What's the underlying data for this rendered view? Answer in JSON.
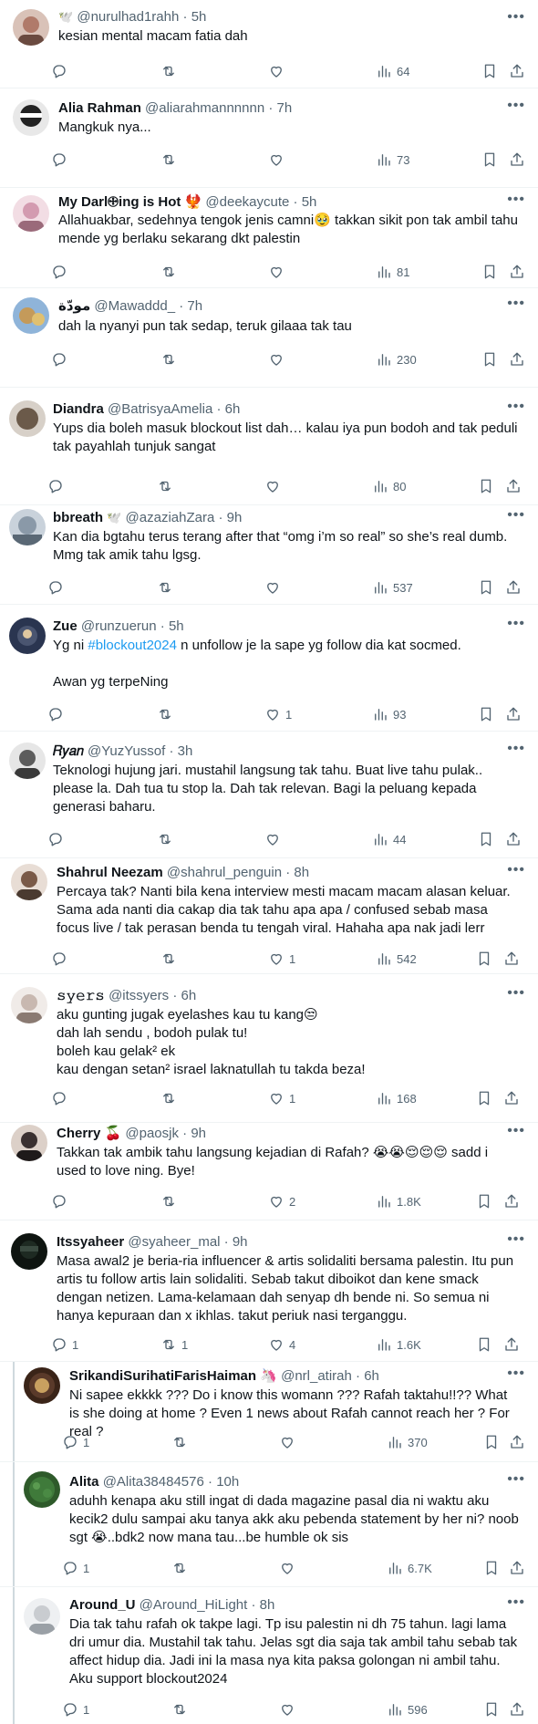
{
  "tweets": [
    {
      "name": "",
      "badge": "🕊️",
      "handle": "@nurulhad1rahh",
      "time": "5h",
      "text": "kesian mental macam fatia dah",
      "replies": "",
      "retweets": "",
      "likes": "",
      "views": "64",
      "avatar_color": "#b07a6a"
    },
    {
      "name": "Alia Rahman",
      "badge": "",
      "handle": "@aliarahmannnnnn",
      "time": "7h",
      "text": "Mangkuk nya...",
      "replies": "",
      "retweets": "",
      "likes": "",
      "views": "73",
      "avatar_color": "#222222"
    },
    {
      "name": "My Darl🕀ing is Hot 🐦‍🔥",
      "badge": "",
      "handle": "@deekaycute",
      "time": "5h",
      "text": "Allahuakbar, sedehnya tengok jenis camni🥹 takkan sikit pon tak ambil tahu mende yg berlaku sekarang dkt palestin",
      "replies": "",
      "retweets": "",
      "likes": "",
      "views": "81",
      "avatar_color": "#d39bb0"
    },
    {
      "name": "مودّة",
      "badge": "",
      "handle": "@Mawaddd_",
      "time": "7h",
      "text": "dah la nyanyi pun tak sedap, teruk gilaaa tak tau",
      "replies": "",
      "retweets": "",
      "likes": "",
      "views": "230",
      "avatar_color": "#c49a5a"
    },
    {
      "name": "Diandra",
      "badge": "",
      "handle": "@BatrisyaAmelia",
      "time": "6h",
      "text": "Yups dia boleh masuk blockout list dah… kalau iya pun bodoh and tak peduli tak payahlah tunjuk sangat",
      "replies": "",
      "retweets": "",
      "likes": "",
      "views": "80",
      "avatar_color": "#6b5a4a"
    },
    {
      "name": "bbreath",
      "badge": "🕊️",
      "handle": "@azaziahZara",
      "time": "9h",
      "text": "Kan dia bgtahu terus terang after that “omg i’m so real” so she’s real dumb. Mmg tak amik tahu lgsg.",
      "replies": "",
      "retweets": "",
      "likes": "",
      "views": "537",
      "avatar_color": "#8a99a8"
    },
    {
      "name": "Zue",
      "badge": "",
      "handle": "@runzuerun",
      "time": "5h",
      "text_before": "Yg ni ",
      "hashtag": "#blockout2024",
      "text_after": " n unfollow je la sape yg follow dia kat socmed.\n\nAwan yg terpeNing",
      "replies": "",
      "retweets": "",
      "likes": "1",
      "views": "93",
      "avatar_color": "#4a5570"
    },
    {
      "name": "𝑅𝑦𝑎𝑛",
      "badge": "",
      "handle": "@YuzYussof",
      "time": "3h",
      "text": "Teknologi hujung jari. mustahil langsung tak tahu. Buat live tahu pulak.. please la. Dah tua tu stop la. Dah tak relevan. Bagi la peluang kepada generasi baharu.",
      "replies": "",
      "retweets": "",
      "likes": "",
      "views": "44",
      "avatar_color": "#5c5c5c"
    },
    {
      "name": "Shahrul Neezam",
      "badge": "",
      "handle": "@shahrul_penguin",
      "time": "8h",
      "text": "Percaya tak? Nanti bila kena interview mesti macam macam alasan keluar. Sama ada nanti dia cakap dia tak tahu apa apa / confused sebab masa focus live / tak perasan benda tu tengah viral. Hahaha apa nak jadi lerr",
      "replies": "",
      "retweets": "",
      "likes": "1",
      "views": "542",
      "avatar_color": "#7a5a48"
    },
    {
      "name": "𝚜𝚢𝚎𝚛𝚜",
      "badge": "",
      "handle": "@itssyers",
      "time": "6h",
      "text": "aku gunting jugak eyelashes kau tu kang😒\ndah lah sendu , bodoh pulak tu!\nboleh kau gelak² ek\nkau dengan setan² israel laknatullah tu takda beza!",
      "replies": "",
      "retweets": "",
      "likes": "1",
      "views": "168",
      "avatar_color": "#c8b8b0"
    },
    {
      "name": "Cherry 🍒",
      "badge": "",
      "handle": "@paosjk",
      "time": "9h",
      "text": "Takkan tak ambik tahu langsung kejadian di Rafah? 😭😭😌😌😌 sadd i used to love ning. Bye!",
      "replies": "",
      "retweets": "",
      "likes": "2",
      "views": "1.8K",
      "avatar_color": "#3a3030"
    },
    {
      "name": "Itssyaheer",
      "badge": "",
      "handle": "@syaheer_mal",
      "time": "9h",
      "text": "Masa awal2 je beria-ria influencer & artis solidaliti bersama palestin. Itu pun artis tu follow artis lain solidaliti. Sebab takut diboikot dan kene smack dengan netizen. Lama-kelamaan dah senyap dh bende ni. So semua ni hanya kepuraan dan x ikhlas. takut periuk nasi terganggu.",
      "replies": "1",
      "retweets": "1",
      "likes": "4",
      "views": "1.6K",
      "avatar_color": "#1e2a22"
    },
    {
      "name": "SrikandiSurihatiFarisHaiman 🦄",
      "badge": "",
      "handle": "@nrl_atirah",
      "time": "6h",
      "text": "Ni sapee ekkkk ??? Do i know this womann ??? Rafah taktahu!!?? What is she doing at home ? Even 1 news about Rafah cannot reach her ? For real ?",
      "replies": "1",
      "retweets": "",
      "likes": "",
      "views": "370",
      "avatar_color": "#5a3a2a"
    },
    {
      "name": "Alita",
      "badge": "",
      "handle": "@Alita38484576",
      "time": "10h",
      "text": "aduhh kenapa aku still ingat di dada magazine pasal dia ni waktu aku kecik2 dulu sampai aku tanya akk aku pebenda statement by her ni? noob sgt 😭..bdk2 now mana tau...be humble ok sis",
      "replies": "1",
      "retweets": "",
      "likes": "",
      "views": "6.7K",
      "avatar_color": "#3f7a3a"
    },
    {
      "name": "Around_U",
      "badge": "",
      "handle": "@Around_HiLight",
      "time": "8h",
      "text": "Dia tak tahu rafah ok takpe lagi. Tp isu palestin ni dh 75 tahun. lagi lama dri umur dia. Mustahil tak tahu. Jelas sgt dia saja tak ambil tahu sebab tak affect hidup dia. Jadi ini la masa nya kita paksa golongan ni ambil tahu. Aku support blockout2024",
      "replies": "1",
      "retweets": "",
      "likes": "",
      "views": "596",
      "avatar_color": "#c9ccd0"
    }
  ]
}
